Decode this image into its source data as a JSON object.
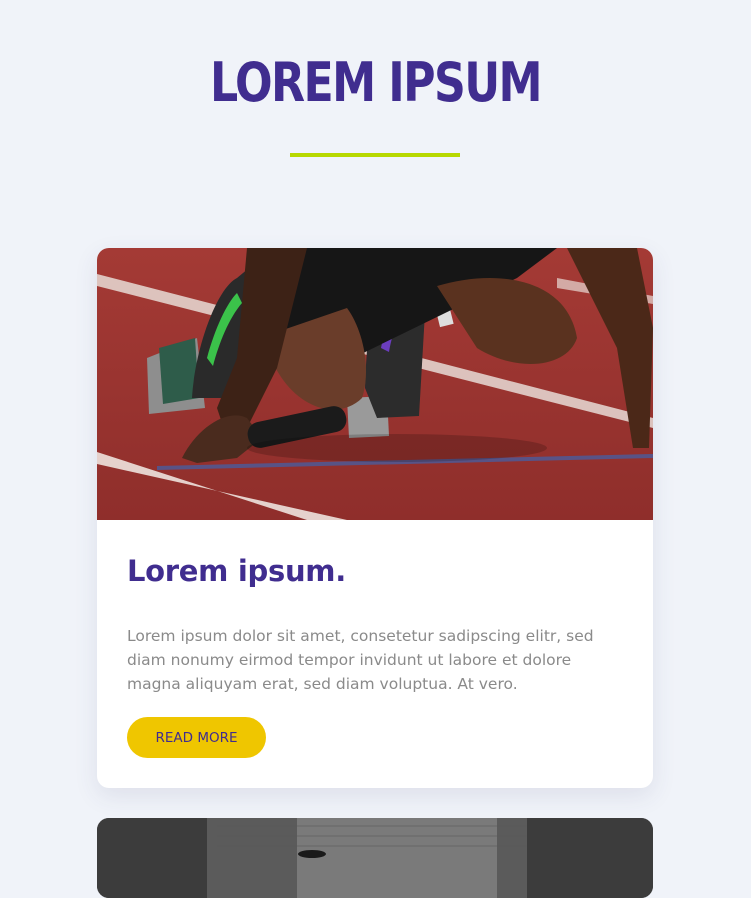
{
  "header": {
    "title": "LOREM IPSUM"
  },
  "colors": {
    "background": "#f0f3f9",
    "title": "#402d8f",
    "underline_accent": "#b7d800",
    "button": "#efc600",
    "body_text": "#8a8a8a"
  },
  "cards": [
    {
      "image": "sprinter-on-track-photo",
      "title": "Lorem ipsum.",
      "body": "Lorem ipsum dolor sit amet, consetetur sadipscing elitr, sed diam nonumy eirmod tempor invidunt ut labore et dolore magna aliquyam erat, sed diam voluptua. At vero.",
      "button_label": "Read more"
    },
    {
      "image": "gym-photo"
    }
  ]
}
